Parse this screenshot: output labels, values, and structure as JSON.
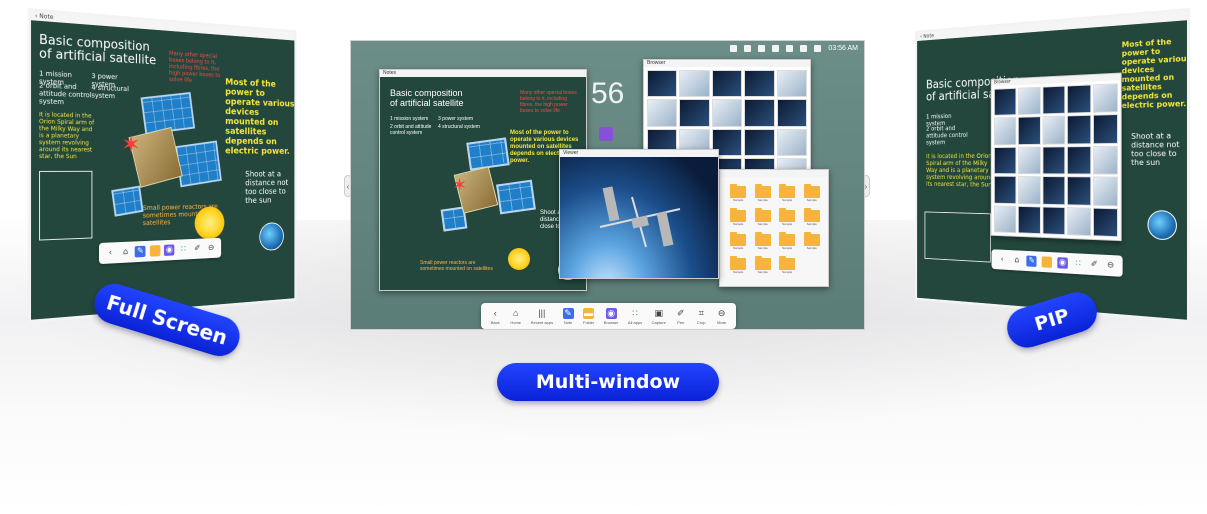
{
  "pills": {
    "full_screen": "Full Screen",
    "multi_window": "Multi-window",
    "pip": "PIP"
  },
  "board": {
    "title_line1": "Basic composition",
    "title_line2": "of artificial satellite",
    "item1": "1 mission system",
    "item2": "3 power system",
    "item3": "2 orbit and attitude control system",
    "item4": "4 structural system",
    "yellow_note": "Most of the power to operate various devices mounted on satellites depends on electric power.",
    "red_note": "Many other special boxes belong to it, including fibres, the high power boxes to solve life",
    "orange_note": "Small power reactors are sometimes mounted on satellites",
    "shoot_note": "Shoot at a distance not too close to the sun",
    "located_note": "It is located in the Orion Spiral arm of the Milky Way and is a planetary system revolving around its nearest star, the Sun"
  },
  "window_titles": {
    "note": "Notes",
    "browser": "Browser",
    "viewer": "Viewer"
  },
  "status": {
    "time": "03:56 AM"
  },
  "clock": {
    "time": "56"
  },
  "dock": [
    {
      "icon": "back-icon",
      "glyph": "‹",
      "label": "Back"
    },
    {
      "icon": "home-icon",
      "glyph": "⌂",
      "label": "Home"
    },
    {
      "icon": "recent-icon",
      "glyph": "|||",
      "label": "Recent apps"
    },
    {
      "icon": "note-icon",
      "glyph": "✎",
      "label": "Note"
    },
    {
      "icon": "folder-icon",
      "glyph": "▬",
      "label": "Folder"
    },
    {
      "icon": "browser-icon",
      "glyph": "◉",
      "label": "Browser"
    },
    {
      "icon": "apps-icon",
      "glyph": "∷",
      "label": "All apps"
    },
    {
      "icon": "capture-icon",
      "glyph": "▣",
      "label": "Capture"
    },
    {
      "icon": "pen-icon",
      "glyph": "✐",
      "label": "Pen"
    },
    {
      "icon": "crop-icon",
      "glyph": "⌗",
      "label": "Crop"
    },
    {
      "icon": "more-icon",
      "glyph": "⊖",
      "label": "More"
    }
  ],
  "folders": [
    "Sample",
    "Sample",
    "Sample",
    "Sample",
    "Sample",
    "Sample",
    "Sample",
    "Sample",
    "Sample",
    "Sample",
    "Sample",
    "Sample",
    "Sample",
    "Sample",
    "Sample"
  ],
  "colors": {
    "pill_blue": "#0a22d6",
    "chalkboard": "#23473d",
    "desktop_bg": "#6d8e88",
    "chalk_yellow": "#f5e83a",
    "chalk_red": "#f04c4c"
  }
}
